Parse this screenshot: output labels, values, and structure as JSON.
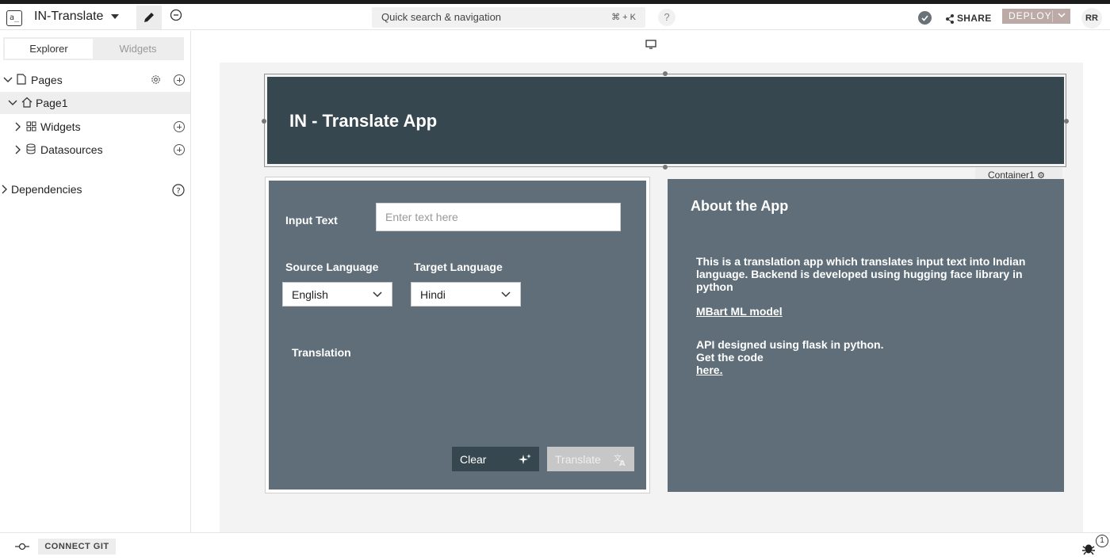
{
  "topbar": {
    "logo_text": "a_",
    "app_name": "IN-Translate",
    "search_placeholder": "Quick search & navigation",
    "search_shortcut": "⌘ + K",
    "help_label": "?",
    "share_label": "SHARE",
    "deploy_label": "DEPLOY",
    "avatar_initials": "RR"
  },
  "sidebar": {
    "tabs": [
      "Explorer",
      "Widgets"
    ],
    "tree": {
      "pages": "Pages",
      "page1": "Page1",
      "widgets": "Widgets",
      "datasources": "Datasources",
      "dependencies": "Dependencies"
    }
  },
  "bottombar": {
    "git_label": "CONNECT GIT",
    "bug_count": "1"
  },
  "canvas": {
    "header_title": "IN - Translate App",
    "container_tag": "Container1",
    "form": {
      "input_label": "Input Text",
      "input_placeholder": "Enter text here",
      "source_label": "Source Language",
      "source_value": "English",
      "target_label": "Target Language",
      "target_value": "Hindi",
      "translation_label": "Translation",
      "clear_label": "Clear",
      "translate_label": "Translate"
    },
    "about": {
      "title": "About the App",
      "description": "This is a translation app which translates input text into Indian language. Backend is developed using hugging face library in python",
      "model_link": "MBart ML model",
      "api_line": "API designed using flask in python.",
      "code_line": "Get the code",
      "code_link": "here."
    }
  },
  "colors": {
    "header_bg": "#37474f",
    "panel_bg": "#5f6e78",
    "deploy_bg": "#bcaaa6"
  }
}
